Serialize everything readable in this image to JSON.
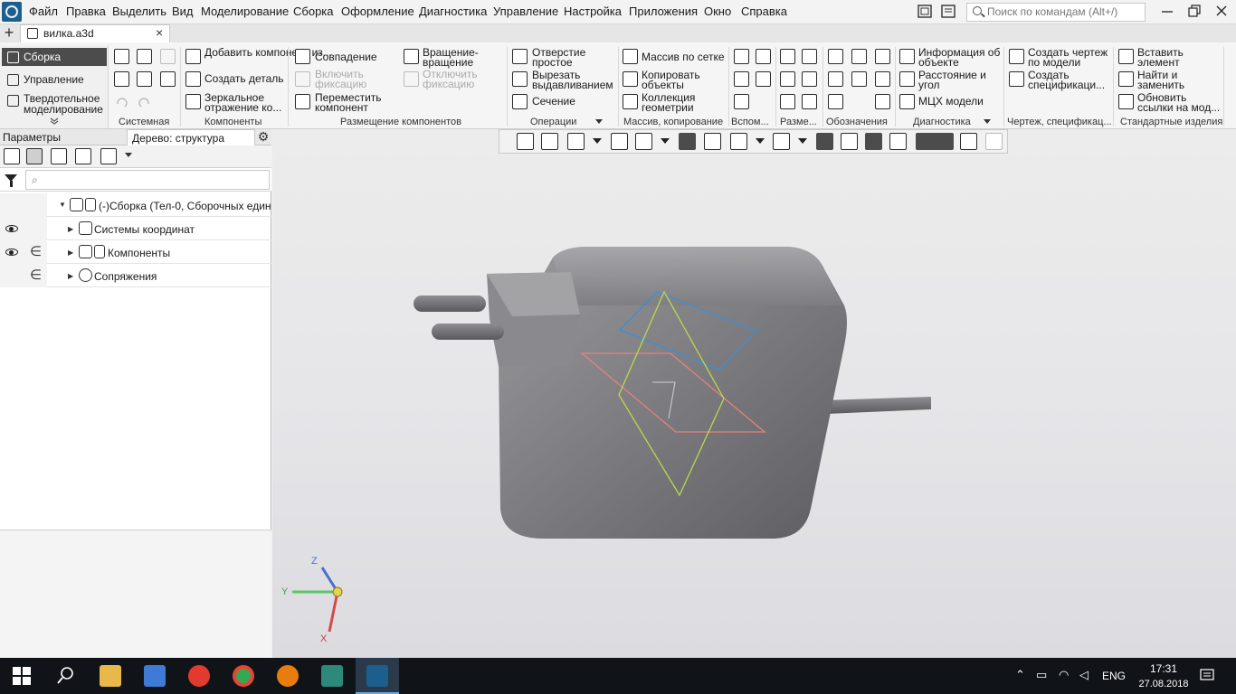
{
  "menu": [
    "Файл",
    "Правка",
    "Выделить",
    "Вид",
    "Моделирование",
    "Сборка",
    "Оформление",
    "Диагностика",
    "Управление",
    "Настройка",
    "Приложения",
    "Окно",
    "Справка"
  ],
  "search_placeholder": "Поиск по командам (Alt+/)",
  "tab": {
    "title": "вилка.a3d"
  },
  "modes": [
    "Сборка",
    "Управление",
    "Твердотельное моделирование"
  ],
  "ribbon": {
    "components": [
      "Добавить компонент из...",
      "Создать деталь",
      "Зеркальное отражение ко..."
    ],
    "placement": [
      "Совпадение",
      "Включить фиксацию",
      "Переместить компонент",
      "Вращение-вращение",
      "Отключить фиксацию"
    ],
    "operations": [
      "Отверстие простое",
      "Вырезать выдавливанием",
      "Сечение"
    ],
    "arrays": [
      "Массив по сетке",
      "Копировать объекты",
      "Коллекция геометрии"
    ],
    "diagnostics": [
      "Информация об объекте",
      "Расстояние и угол",
      "МЦХ модели"
    ],
    "drawings": [
      "Создать чертеж по модели",
      "Создать спецификаци..."
    ],
    "standard": [
      "Вставить элемент",
      "Найти и заменить",
      "Обновить ссылки на мод..."
    ],
    "groups": [
      "Системная",
      "Компоненты",
      "Размещение компонентов",
      "Операции",
      "Массив, копирование",
      "Вспом...",
      "Разме...",
      "Обозначения",
      "Диагностика",
      "Чертеж, спецификац...",
      "Стандартные изделия"
    ]
  },
  "panel": {
    "tab_params": "Параметры",
    "tab_tree": "Дерево: структура",
    "filter_glyph": "⌕"
  },
  "tree": {
    "root": "(-)Сборка (Тел-0, Сборочных един",
    "items": [
      "Системы координат",
      "Компоненты",
      "Сопряжения"
    ]
  },
  "axes": {
    "z": "Z",
    "y": "Y",
    "x": "X"
  },
  "taskbar": {
    "time": "17:31",
    "date": "27.08.2018",
    "lang": "ENG"
  },
  "colors": {
    "menu_bg": "#f3f3f3",
    "active_mode": "#4c4c4c",
    "taskbar": "#101418",
    "plane_blue": "#3a8fd8",
    "plane_red": "#e8807a",
    "plane_green": "#b9d84a"
  }
}
